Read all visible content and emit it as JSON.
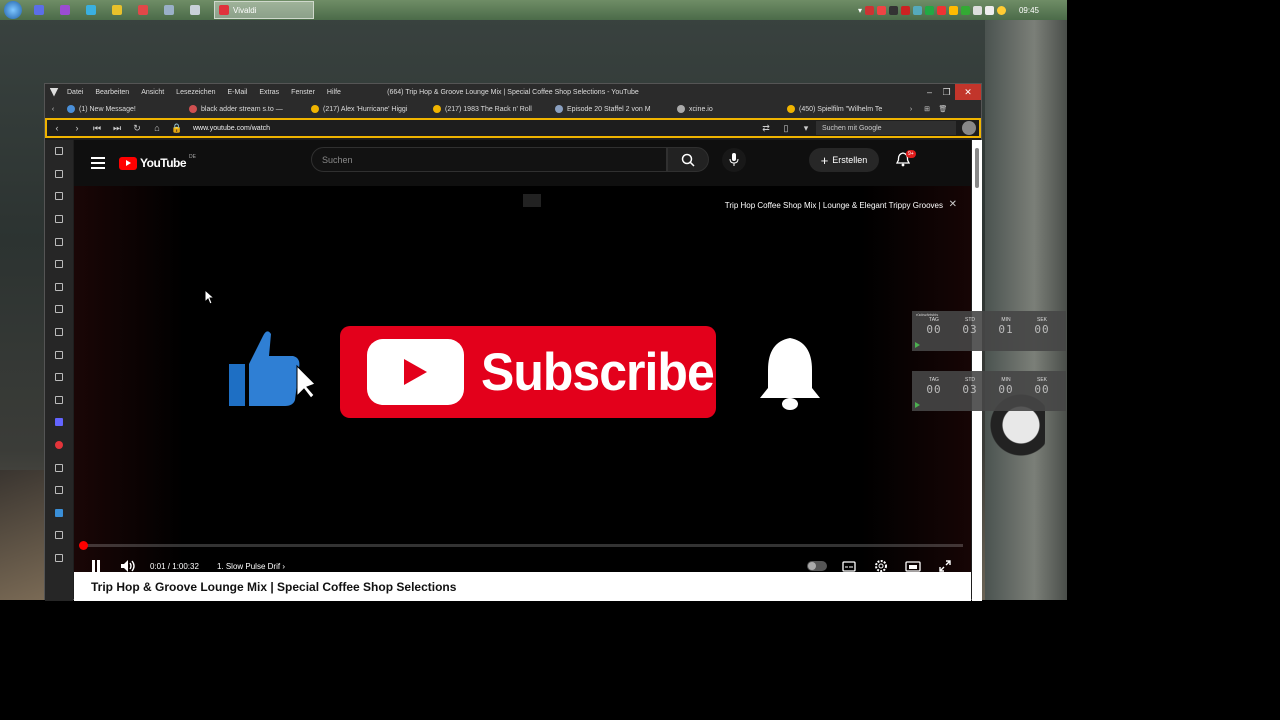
{
  "taskbar": {
    "active_task": "Vivaldi",
    "clock": "09:45",
    "quicklaunch": [
      {
        "name": "blue-app-icon",
        "color": "#5b6ee8"
      },
      {
        "name": "purple-app-icon",
        "color": "#9b4dd1"
      },
      {
        "name": "vpn-icon",
        "color": "#3ab0e0"
      },
      {
        "name": "yellow-app-icon",
        "color": "#e8c12b"
      },
      {
        "name": "red-app-icon",
        "color": "#e04848"
      },
      {
        "name": "document-app-icon",
        "color": "#9ab0c8"
      },
      {
        "name": "window-app-icon",
        "color": "#c8d0d8"
      }
    ]
  },
  "window": {
    "title": "(664) Trip Hop & Groove Lounge Mix | Special Coffee Shop Selections - YouTube",
    "menu": [
      "Datei",
      "Bearbeiten",
      "Ansicht",
      "Lesezeichen",
      "E-Mail",
      "Extras",
      "Fenster",
      "Hilfe"
    ]
  },
  "tabs": [
    {
      "label": "(1) New Message!",
      "color": "#4a8fd8"
    },
    {
      "label": "black adder stream s.to —",
      "color": "#d05050"
    },
    {
      "label": "(217) Alex 'Hurricane' Higgi",
      "color": "#f0b400"
    },
    {
      "label": "(217) 1983 The Rack n' Roll",
      "color": "#f0b400"
    },
    {
      "label": "Episode 20 Staffel 2 von M",
      "color": "#8aa0c0"
    },
    {
      "label": "xcine.io",
      "color": "#aaaaaa"
    },
    {
      "label": "(450) Spielfilm \"Wilhelm Te",
      "color": "#f0b400"
    }
  ],
  "address": {
    "url": "www.youtube.com/watch",
    "search_placeholder": "Suchen mit Google"
  },
  "youtube": {
    "logo_text": "YouTube",
    "logo_region": "DE",
    "search_placeholder": "Suchen",
    "create_label": "Erstellen",
    "notifications_badge": "9+",
    "video_overlay_title": "Trip Hop Coffee Shop Mix | Lounge & Elegant Trippy Grooves",
    "subscribe_text": "Subscribe",
    "time": "0:01 / 1:00:32",
    "chapter": "1. Slow Pulse Drif",
    "progress": 0.0003,
    "below_title": "Trip Hop & Groove Lounge Mix | Special Coffee Shop Selections"
  },
  "widgets": [
    {
      "label": "rückwärtsbis",
      "units": [
        "TAG",
        "STD",
        "MIN",
        "SEK"
      ],
      "values": [
        "00",
        "03",
        "01",
        "00"
      ]
    },
    {
      "label": "",
      "units": [
        "TAG",
        "STD",
        "MIN",
        "SEK"
      ],
      "values": [
        "00",
        "03",
        "00",
        "00"
      ]
    }
  ]
}
